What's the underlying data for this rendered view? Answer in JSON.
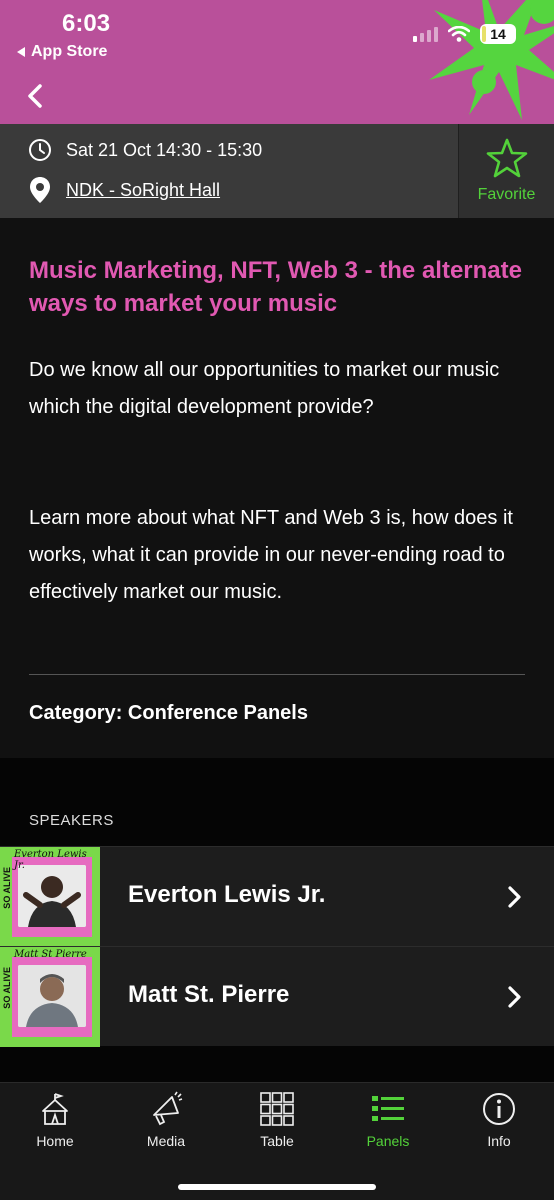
{
  "status_bar": {
    "time": "6:03",
    "back_app_label": "App Store",
    "battery": "14",
    "battery_level": 0.14
  },
  "session": {
    "datetime": "Sat 21 Oct 14:30 - 15:30",
    "location": "NDK - SoRight Hall",
    "favorite_label": "Favorite",
    "title": "Music Marketing, NFT, Web 3 - the alternate ways to market your music",
    "paragraphs": [
      "Do we know all our opportunities to market our music which the digital development provide?",
      "Learn more about what NFT and Web 3 is, how does it works, what it can provide in our never-ending road to effectively market our music."
    ],
    "category": "Category: Conference Panels"
  },
  "speakers": {
    "label": "SPEAKERS",
    "items": [
      {
        "name": "Everton Lewis Jr.",
        "thumb_name": "Everton Lewis Jr.",
        "thumb_side": "SO ALIVE"
      },
      {
        "name": "Matt St. Pierre",
        "thumb_name": "Matt St Pierre",
        "thumb_side": "SO ALIVE"
      }
    ]
  },
  "tabs": [
    {
      "label": "Home",
      "icon": "tent-icon",
      "active": false
    },
    {
      "label": "Media",
      "icon": "megaphone-icon",
      "active": false
    },
    {
      "label": "Table",
      "icon": "grid-icon",
      "active": false
    },
    {
      "label": "Panels",
      "icon": "list-icon",
      "active": true
    },
    {
      "label": "Info",
      "icon": "info-icon",
      "active": false
    }
  ],
  "colors": {
    "header_bg": "#b9509a",
    "title_pink": "#e159b2",
    "accent_green": "#53d23a"
  }
}
